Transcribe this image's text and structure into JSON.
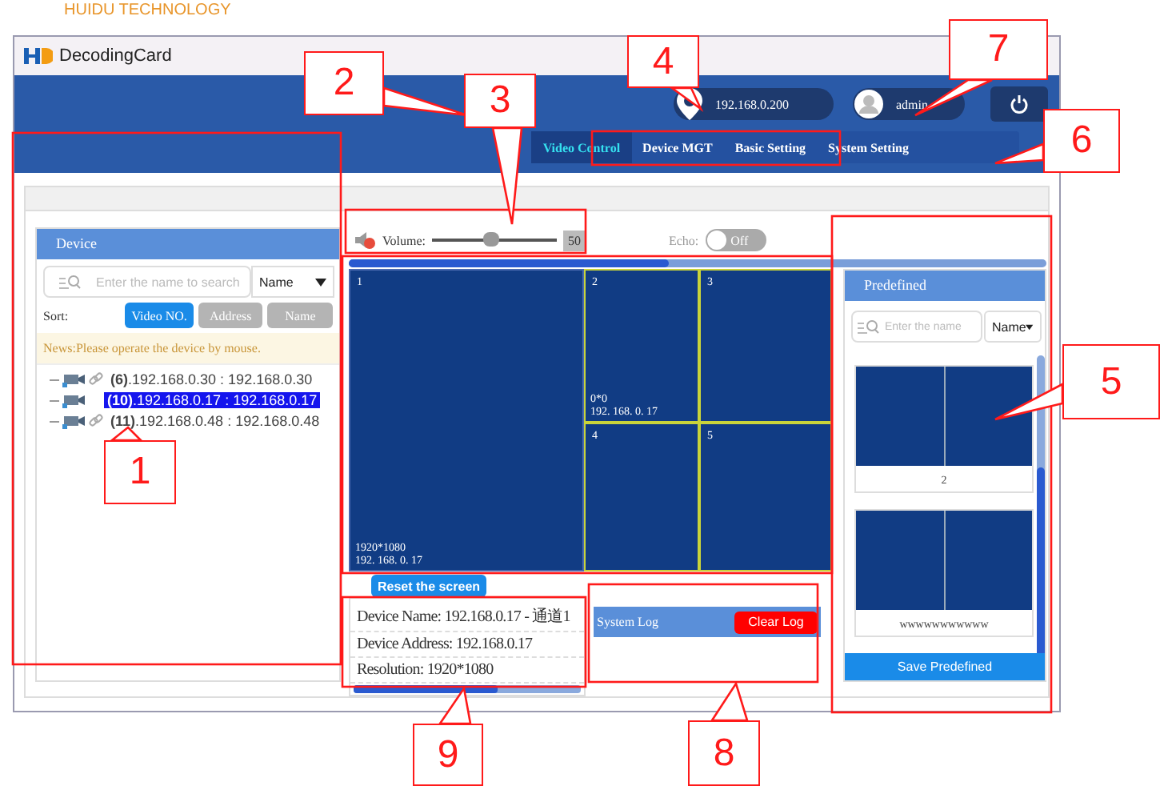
{
  "header_text": "HUIDU TECHNOLOGY",
  "window": {
    "title": "DecodingCard"
  },
  "connection": {
    "ip": "192.168.0.200",
    "user": "admin"
  },
  "nav_tabs": [
    {
      "label": "Video Control",
      "selected": true
    },
    {
      "label": "Device MGT",
      "selected": false
    },
    {
      "label": "Basic Setting",
      "selected": false
    },
    {
      "label": "System Setting",
      "selected": false
    }
  ],
  "device_panel": {
    "title": "Device",
    "search_placeholder": "Enter the name to search",
    "search_by": "Name",
    "sort_label": "Sort:",
    "sort_buttons": [
      {
        "label": "Video NO.",
        "selected": true
      },
      {
        "label": "Address",
        "selected": false
      },
      {
        "label": "Name",
        "selected": false
      }
    ],
    "notice": "News:Please operate the device by mouse.",
    "devices": [
      {
        "number": "(6)",
        "address": ".192.168.0.30 : 192.168.0.30",
        "selected": false,
        "linked": true
      },
      {
        "number": "(10)",
        "address": ".192.168.0.17 : 192.168.0.17",
        "selected": true,
        "linked": false
      },
      {
        "number": "(11)",
        "address": ".192.168.0.48 : 192.168.0.48",
        "selected": false,
        "linked": true
      }
    ]
  },
  "volume": {
    "label": "Volume:",
    "level": 0.48,
    "value": "50"
  },
  "echo": {
    "label": "Echo:",
    "on": false,
    "state_text": "Off"
  },
  "screens": [
    {
      "number": "1",
      "resolution": "1920*1080",
      "address": "192. 168. 0. 17"
    },
    {
      "number": "2",
      "resolution": "0*0",
      "address": "192. 168. 0. 17"
    },
    {
      "number": "3"
    },
    {
      "number": "4"
    },
    {
      "number": "5"
    }
  ],
  "reset_button": "Reset the screen",
  "device_info": [
    {
      "label": "Device Name:",
      "value": "192.168.0.17 - 通道1"
    },
    {
      "label": "Device Address:",
      "value": "192.168.0.17"
    },
    {
      "label": "Resolution:",
      "value": "1920*1080"
    }
  ],
  "system_log": {
    "title": "System Log",
    "clear_button": "Clear Log"
  },
  "predefined": {
    "title": "Predefined",
    "search_placeholder": "Enter the name",
    "search_by": "Name",
    "presets": [
      {
        "name": "2"
      },
      {
        "name": "wwwwwwwwwww"
      }
    ],
    "save_button": "Save Predefined"
  },
  "annotations": [
    {
      "label": "1"
    },
    {
      "label": "2"
    },
    {
      "label": "3"
    },
    {
      "label": "4"
    },
    {
      "label": "5"
    },
    {
      "label": "6"
    },
    {
      "label": "7"
    },
    {
      "label": "8"
    },
    {
      "label": "9"
    }
  ]
}
